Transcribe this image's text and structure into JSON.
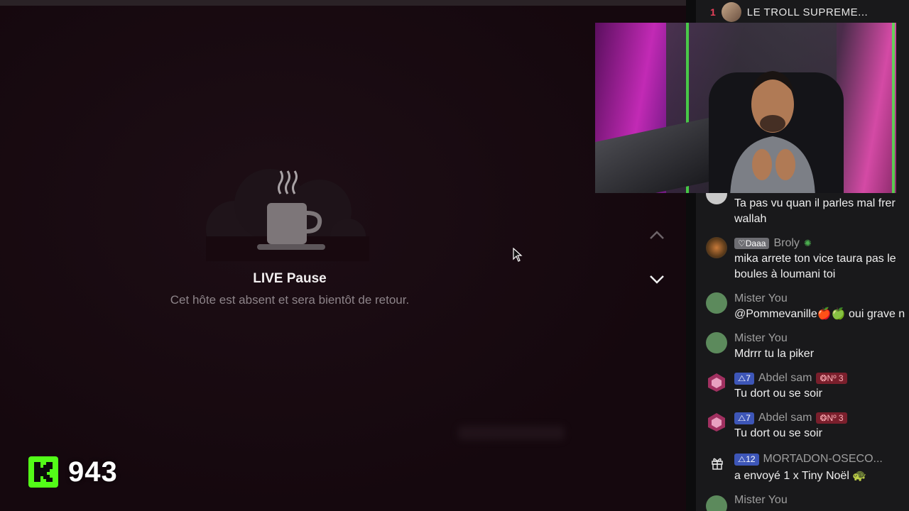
{
  "stream": {
    "pause_title": "LIVE Pause",
    "pause_subtitle": "Cet hôte est absent et sera bientôt de retour.",
    "viewer_count": "943"
  },
  "chat": {
    "top_gifter": {
      "rank": "1",
      "name": "LE TROLL SUPREME..."
    },
    "messages": [
      {
        "name": "",
        "text": "Ta pas vu quan il parles mal frer\nwallah"
      },
      {
        "badge": "Daaa",
        "name": "Broly",
        "text": "mika arrete ton vice taura pas le\nboules à loumani toi"
      },
      {
        "name": "Mister You",
        "text": "@Pommevanille🍎🍏 oui grave n"
      },
      {
        "name": "Mister You",
        "text": "Mdrrr tu la piker"
      },
      {
        "level": "7",
        "name": "Abdel sam",
        "rank_badge": "Nº 3",
        "text": "Tu dort ou se soir"
      },
      {
        "level": "7",
        "name": "Abdel sam",
        "rank_badge": "Nº 3",
        "text": "Tu dort ou se soir"
      },
      {
        "level": "12",
        "name": "MORTADON-OSECO...",
        "text": "a envoyé 1 x Tiny Noël 🐢"
      },
      {
        "name": "Mister You",
        "text": ""
      }
    ]
  },
  "colors": {
    "accent_green": "#53fc18",
    "rank_red": "#e8415a",
    "level_blue": "#3d56b8"
  }
}
